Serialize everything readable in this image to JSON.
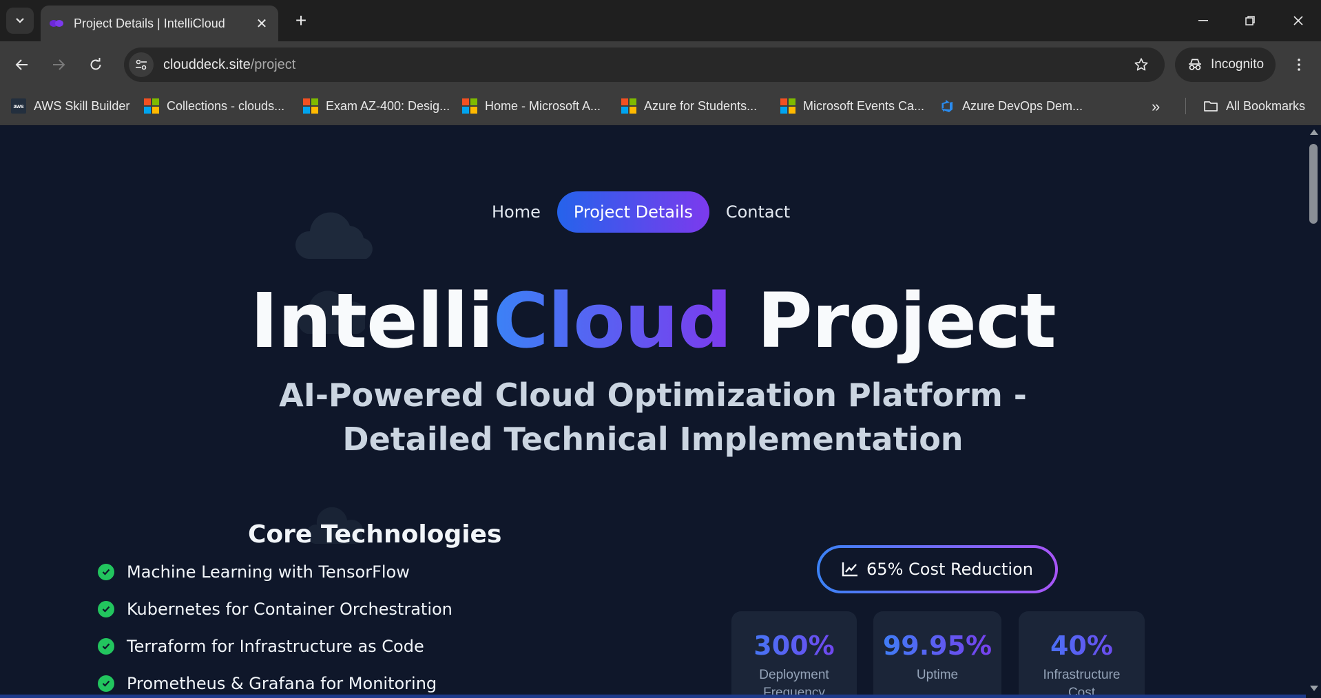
{
  "browser": {
    "tab": {
      "title": "Project Details | IntelliCloud"
    },
    "url": {
      "host": "clouddeck.site",
      "path": "/project"
    },
    "incognito_label": "Incognito",
    "bookmarks": [
      {
        "label": "AWS Skill Builder",
        "icon": "aws-icon"
      },
      {
        "label": "Collections - clouds...",
        "icon": "microsoft-icon"
      },
      {
        "label": "Exam AZ-400: Desig...",
        "icon": "microsoft-icon"
      },
      {
        "label": "Home - Microsoft A...",
        "icon": "microsoft-icon"
      },
      {
        "label": "Azure for Students...",
        "icon": "microsoft-icon"
      },
      {
        "label": "Microsoft Events Ca...",
        "icon": "microsoft-icon"
      },
      {
        "label": "Azure DevOps Dem...",
        "icon": "azure-devops-icon"
      }
    ],
    "all_bookmarks_label": "All Bookmarks"
  },
  "page": {
    "nav": [
      {
        "label": "Home"
      },
      {
        "label": "Project Details"
      },
      {
        "label": "Contact"
      }
    ],
    "hero": {
      "title_part1": "Intelli",
      "title_accent": "Cloud",
      "title_part2": " Project",
      "subtitle": "AI-Powered Cloud Optimization Platform - Detailed Technical Implementation"
    },
    "core": {
      "title": "Core Technologies",
      "items": [
        "Machine Learning with TensorFlow",
        "Kubernetes for Container Orchestration",
        "Terraform for Infrastructure as Code",
        "Prometheus & Grafana for Monitoring"
      ]
    },
    "badge": "65% Cost Reduction",
    "stats": [
      {
        "value": "300%",
        "label": "Deployment Frequency"
      },
      {
        "value": "99.95%",
        "label": "Uptime"
      },
      {
        "value": "40%",
        "label": "Infrastructure Cost"
      }
    ]
  },
  "colors": {
    "page_bg": "#0f172a",
    "accent_start": "#3b82f6",
    "accent_end": "#7c3aed",
    "check": "#22c55e"
  }
}
